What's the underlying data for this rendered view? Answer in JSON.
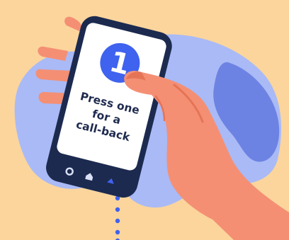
{
  "illustration": {
    "badge_number": "1",
    "message_lines": [
      "Press one",
      "for a",
      "call-back"
    ],
    "nav_icons": [
      "circle-icon",
      "home-icon",
      "back-icon"
    ],
    "colors": {
      "background": "#FBD59C",
      "blob_light": "#A9BAF6",
      "blob_dark": "#6D83E3",
      "phone_body": "#1C2A4F",
      "screen": "#FFFFFF",
      "badge": "#3F62EF",
      "skin": "#F48F74",
      "skin_shadow": "#E57456",
      "dots": "#3F62EF"
    }
  }
}
